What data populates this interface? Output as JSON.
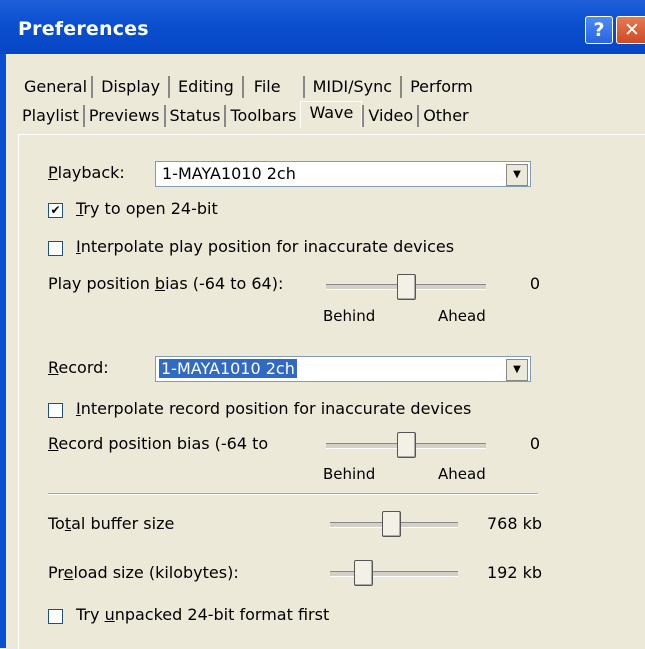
{
  "window": {
    "title": "Preferences",
    "help_glyph": "?",
    "close_glyph": "✕"
  },
  "tabs_row1": [
    "General",
    "Display",
    "Editing",
    "File",
    "MIDI/Sync",
    "Perform"
  ],
  "tabs_row2": [
    "Playlist",
    "Previews",
    "Status",
    "Toolbars",
    "Wave",
    "Video",
    "Other"
  ],
  "selected_tab": "Wave",
  "playback": {
    "label_prefix": "P",
    "label_rest": "layback:",
    "device": "1-MAYA1010 2ch",
    "try24_check": "✔",
    "try24_prefix": "",
    "try24_u": "T",
    "try24_rest": "ry to open 24-bit",
    "interp_u": "I",
    "interp_rest": "nterpolate play position for inaccurate devices",
    "bias_pre": "Play position ",
    "bias_u": "b",
    "bias_rest": "ias (-64 to 64):",
    "bias_value": "0",
    "bias_level": 0.0,
    "behind": "Behind",
    "ahead": "Ahead"
  },
  "record": {
    "label_u": "R",
    "label_rest": "ecord:",
    "device": "1-MAYA1010 2ch",
    "interp_u": "I",
    "interp_rest": "nterpolate record position for inaccurate devices",
    "bias_u": "R",
    "bias_rest": "ecord position bias (-64 to",
    "bias_value": "0",
    "bias_level": 0.0,
    "behind": "Behind",
    "ahead": "Ahead"
  },
  "buffer": {
    "total_pre": "To",
    "total_u": "t",
    "total_rest": "al buffer size",
    "total_value": "768 kb",
    "preload_pre": "Pr",
    "preload_u": "e",
    "preload_rest": "load size (kilobytes):",
    "preload_value": "192 kb",
    "unpacked_pre": "Try ",
    "unpacked_u": "u",
    "unpacked_rest": "npacked 24-bit format first"
  },
  "colors": {
    "title_bar": "#0a4fd0",
    "dialog_bg": "#ece9d8",
    "selection": "#316ac5"
  }
}
